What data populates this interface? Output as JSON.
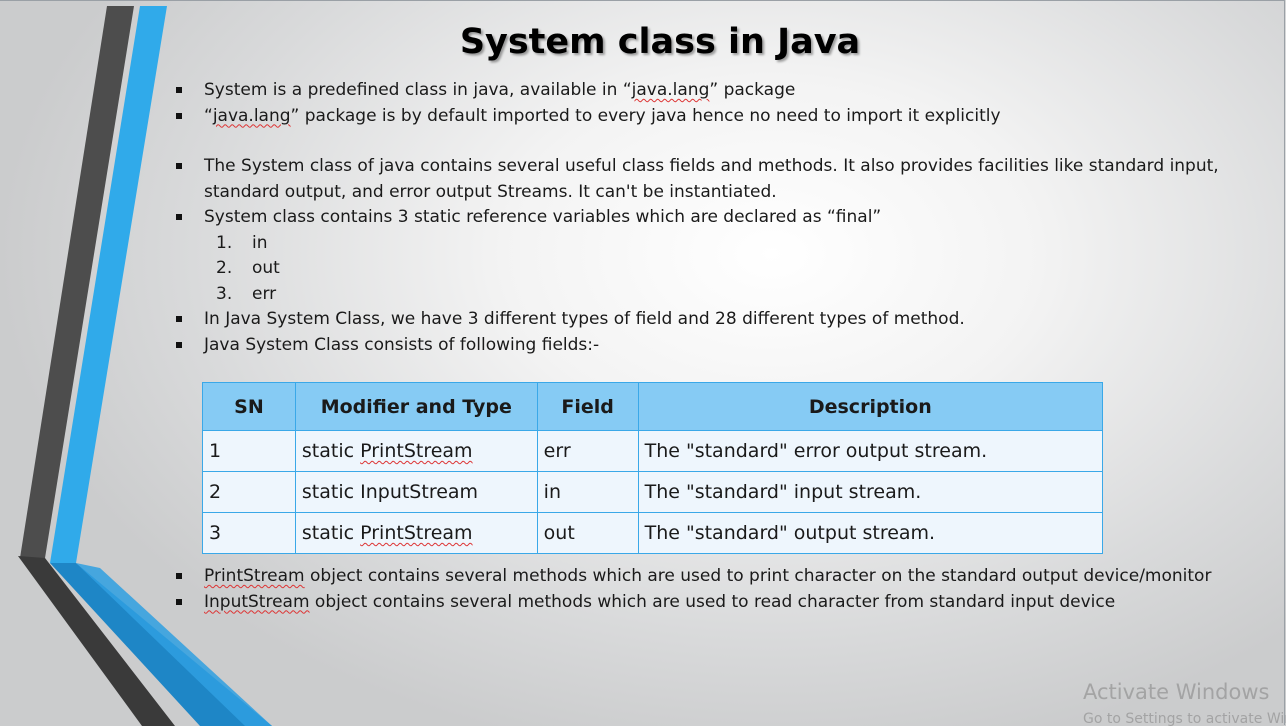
{
  "slide": {
    "title": "System class in Java",
    "bullets_top": [
      {
        "pre": "System is a predefined class in java, available in “",
        "squig": "java.lang",
        "post": "” package"
      },
      {
        "pre": "“",
        "squig": "java.lang",
        "post": "” package is by default imported to every java hence no need to import it explicitly"
      }
    ],
    "bullet_instantiated": "The System class of java contains several useful class fields and methods. It also provides facilities like standard input, standard output, and error output Streams. It can't be instantiated.",
    "bullet_static_vars": "System class contains 3 static reference variables which are declared as “final”",
    "numbered": [
      {
        "n": "1.",
        "text": "in"
      },
      {
        "n": "2.",
        "text": "out"
      },
      {
        "n": "3.",
        "text": "err"
      }
    ],
    "bullet_types": "In Java System Class, we have 3 different types of field and 28 different types of method.",
    "bullet_fields": "Java System Class consists of following fields:-",
    "table": {
      "headers": [
        "SN",
        "Modifier and Type",
        "Field",
        "Description"
      ],
      "rows": [
        {
          "sn": "1",
          "mod_pre": "static ",
          "mod_type": "PrintStream",
          "field": "err",
          "desc": "The \"standard\" error output stream."
        },
        {
          "sn": "2",
          "mod_pre": "static ",
          "mod_type": "InputStream",
          "field": "in",
          "desc": "The \"standard\" input stream."
        },
        {
          "sn": "3",
          "mod_pre": "static ",
          "mod_type": "PrintStream",
          "field": "out",
          "desc": "The \"standard\" output stream."
        }
      ]
    },
    "bullets_bottom": [
      {
        "squig": "PrintStream",
        "post": " object contains several methods which are used to print character on the standard output device/monitor"
      },
      {
        "squig": "InputStream",
        "post": " object contains several methods which are used to read character from standard input device"
      }
    ]
  },
  "watermark": {
    "line1": "Activate Windows",
    "line2": "Go to Settings to activate Windows."
  },
  "colors": {
    "table_header": "#86cbf4",
    "table_border": "#3aa8e8",
    "table_cell": "#eef6fd",
    "accent_blue": "#2ea6e6",
    "accent_gray": "#4a4a4a"
  }
}
